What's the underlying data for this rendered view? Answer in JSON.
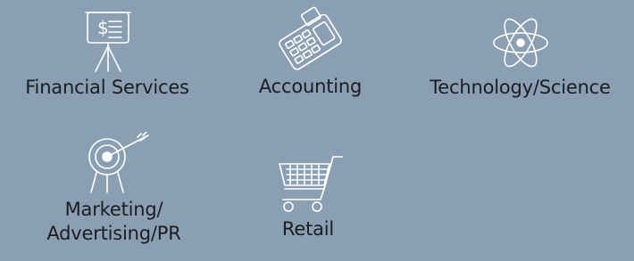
{
  "categories": [
    {
      "id": "financial",
      "label_lines": [
        "Financial Services"
      ],
      "icon": "presentation-board-dollar-icon"
    },
    {
      "id": "accounting",
      "label_lines": [
        "Accounting"
      ],
      "icon": "adding-machine-icon"
    },
    {
      "id": "technology",
      "label_lines": [
        "Technology/Science"
      ],
      "icon": "atom-icon"
    },
    {
      "id": "marketing",
      "label_lines": [
        "Marketing/",
        "Advertising/PR"
      ],
      "icon": "target-arrow-icon"
    },
    {
      "id": "retail",
      "label_lines": [
        "Retail"
      ],
      "icon": "shopping-cart-icon"
    }
  ],
  "icon_glyphs": {
    "dollar": "$"
  },
  "colors": {
    "background": "#8a9fb2",
    "icon_stroke": "#ffffff",
    "text": "#1a1d21"
  }
}
